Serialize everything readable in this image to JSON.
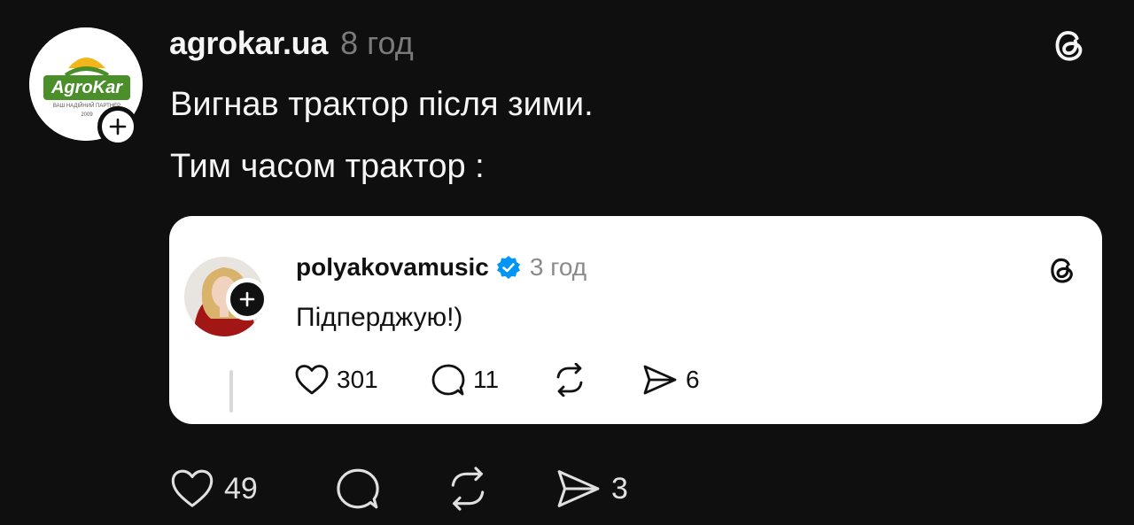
{
  "post": {
    "author": "agrokar.ua",
    "time": "8 год",
    "lines": [
      "Вигнав трактор після зими.",
      "Тим часом трактор :"
    ],
    "avatar_logo_text": "AgroKar",
    "avatar_tagline": "ВАШ НАДІЙНИЙ ПАРТНЕР",
    "avatar_year": "2009",
    "likes": "49",
    "shares": "3"
  },
  "quote": {
    "author": "polyakovamusic",
    "time": "3 год",
    "text": "Підперджую!)",
    "likes": "301",
    "replies": "11",
    "shares": "6"
  },
  "icons": {
    "threads": "threads-logo-icon",
    "follow": "plus-icon",
    "verified": "verified-badge-icon",
    "like": "heart-icon",
    "reply": "comment-icon",
    "repost": "repost-icon",
    "share": "send-icon"
  },
  "colors": {
    "background": "#0f0f0f",
    "verified": "#0095f6",
    "logo_green": "#4a8f2a",
    "logo_yellow": "#f2b61b"
  }
}
